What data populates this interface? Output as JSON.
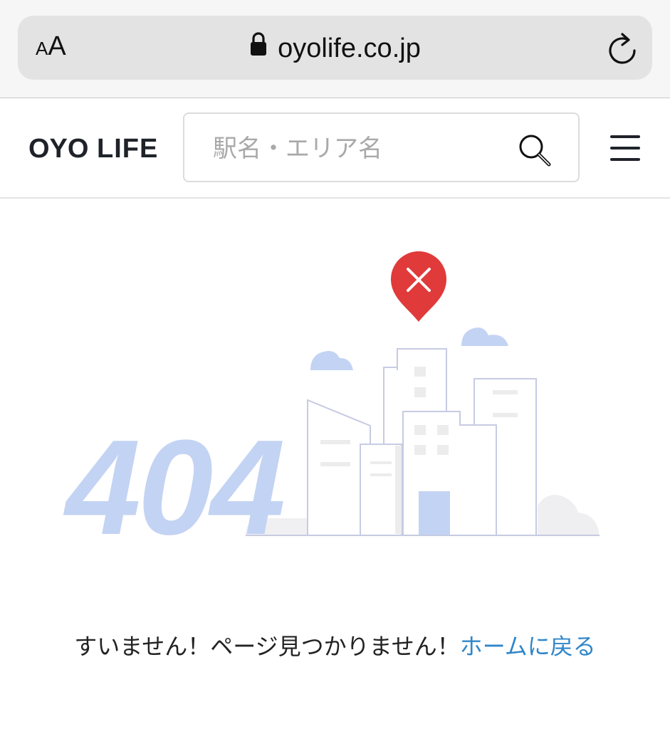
{
  "browser": {
    "text_size_small": "A",
    "text_size_big": "A",
    "url": "oyolife.co.jp"
  },
  "header": {
    "logo_oyo": "OYO",
    "logo_life": "LIFE",
    "search_placeholder": "駅名・エリア名"
  },
  "error": {
    "code": "404",
    "message": "すいません！ページ見つかりません！",
    "home_link": "ホームに戻る"
  },
  "colors": {
    "accent_link": "#2f86c9",
    "illustration_blue": "#c3d3f3",
    "error_pin": "#e03a3a"
  }
}
